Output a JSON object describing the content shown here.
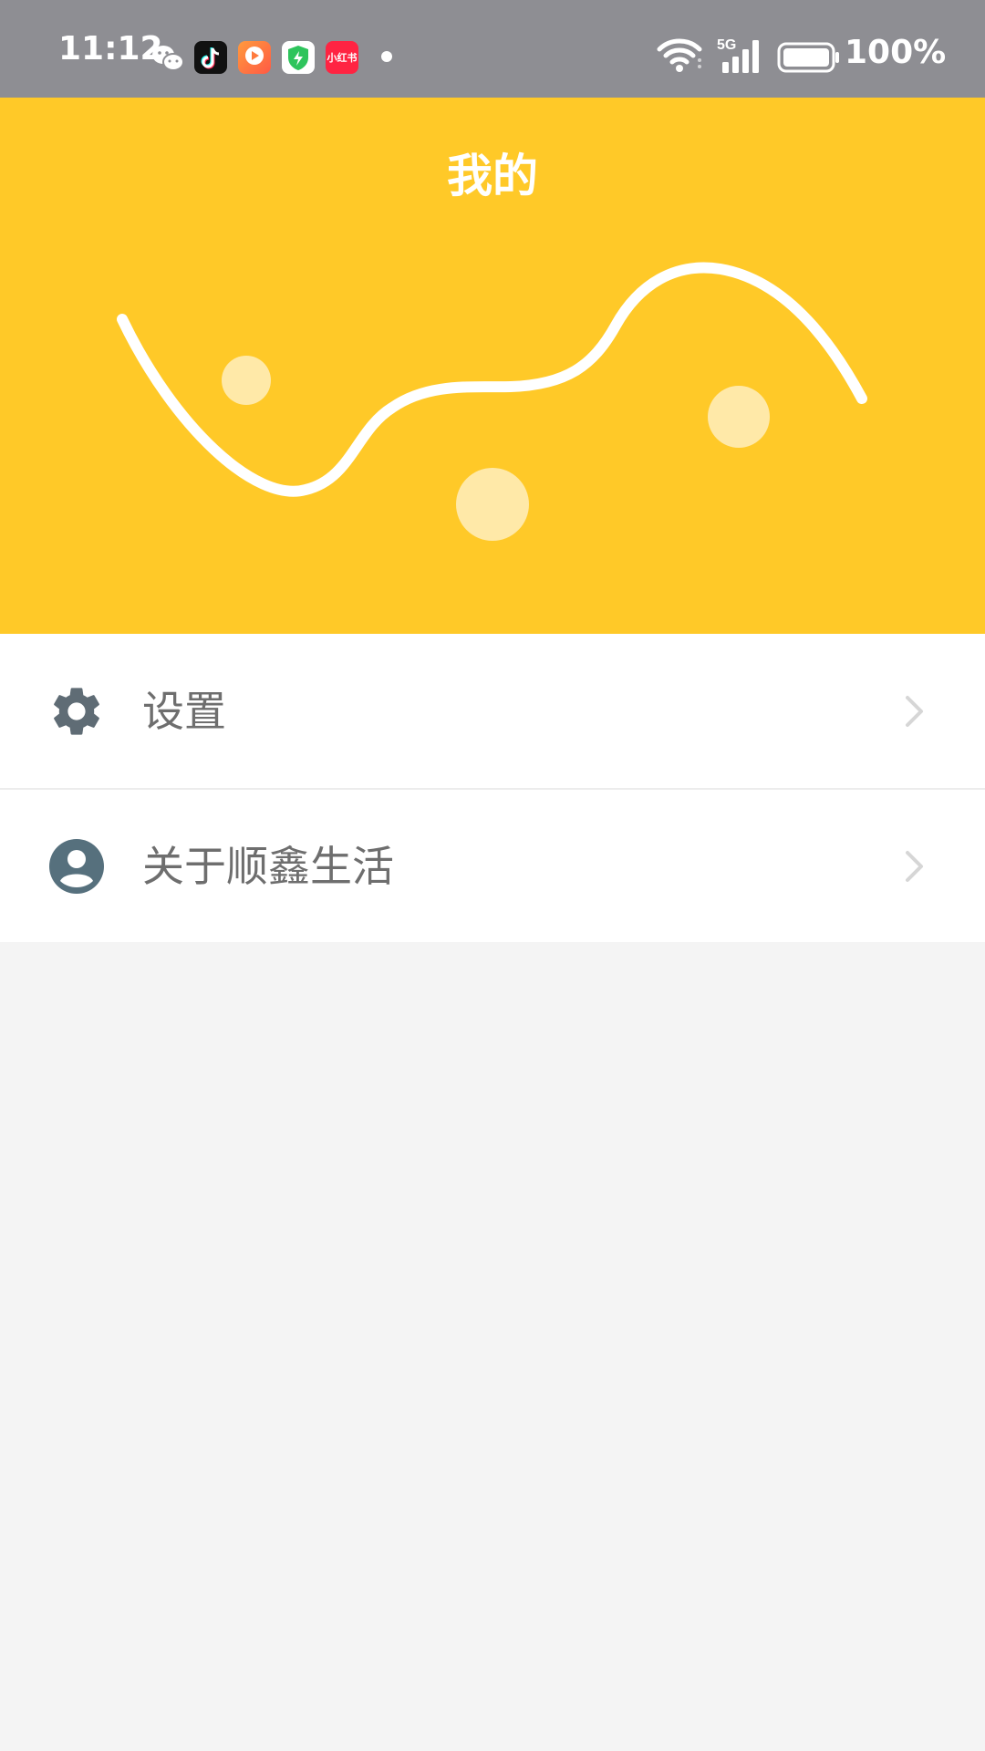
{
  "status_bar": {
    "time": "11:12",
    "battery": "100%",
    "network": "5G",
    "notification_icons": [
      "wechat-icon",
      "tiktok-icon",
      "video-app-icon",
      "security-shield-icon",
      "xiaohongshu-icon"
    ],
    "xhs_label": "小红书"
  },
  "header": {
    "title": "我的",
    "background_color": "#ffc928"
  },
  "menu": {
    "items": [
      {
        "label": "设置",
        "icon": "gear-icon"
      },
      {
        "label": "关于顺鑫生活",
        "icon": "account-circle-icon"
      }
    ]
  },
  "colors": {
    "status_bar": "#8e8e93",
    "banner": "#ffc928",
    "menu_text": "#6e6e6e",
    "icon": "#5f6c75",
    "page_bg": "#f4f4f4"
  }
}
